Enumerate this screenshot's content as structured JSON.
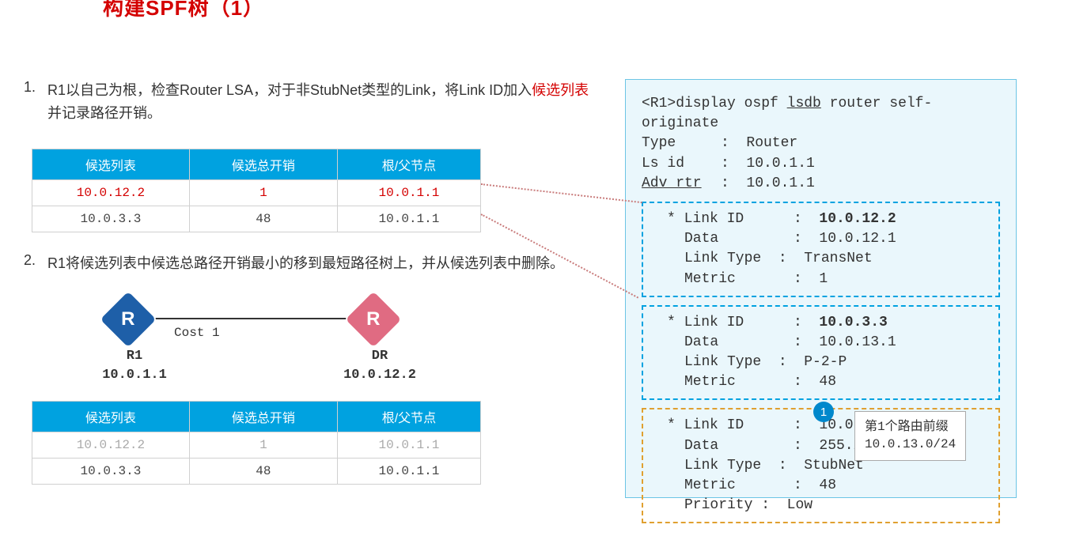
{
  "title": "构建SPF树（1）",
  "step1": {
    "num": "1.",
    "text_before": "R1以自己为根，检查Router LSA，对于非StubNet类型的Link，将Link ID加入",
    "highlight": "候选列表",
    "text_after": "并记录路径开销。"
  },
  "table1": {
    "headers": [
      "候选列表",
      "候选总开销",
      "根/父节点"
    ],
    "rows": [
      {
        "cells": [
          "10.0.12.2",
          "1",
          "10.0.1.1"
        ],
        "class": "red"
      },
      {
        "cells": [
          "10.0.3.3",
          "48",
          "10.0.1.1"
        ],
        "class": ""
      }
    ]
  },
  "step2": {
    "num": "2.",
    "text": "R1将候选列表中候选总路径开销最小的移到最短路径树上，并从候选列表中删除。"
  },
  "topo": {
    "cost_label": "Cost 1",
    "r1": {
      "name": "R1",
      "id": "10.0.1.1"
    },
    "dr": {
      "name": "DR",
      "id": "10.0.12.2"
    }
  },
  "table2": {
    "headers": [
      "候选列表",
      "候选总开销",
      "根/父节点"
    ],
    "rows": [
      {
        "cells": [
          "10.0.12.2",
          "1",
          "10.0.1.1"
        ],
        "class": "grey"
      },
      {
        "cells": [
          "10.0.3.3",
          "48",
          "10.0.1.1"
        ],
        "class": ""
      }
    ]
  },
  "lsdb": {
    "cmd_prefix": "<R1>display ospf ",
    "cmd_u1": "lsdb",
    "cmd_mid": " router self-originate",
    "type_label": "Type",
    "type_value": "Router",
    "lsid_label": "Ls id",
    "lsid_value": "10.0.1.1",
    "adv_label": "Adv rtr",
    "adv_value": "10.0.1.1",
    "links": [
      {
        "box_class": "dash-blue",
        "link_id_label": "* Link ID",
        "link_id": "10.0.12.2",
        "link_id_bold": true,
        "data_label": "Data",
        "data": "10.0.12.1",
        "type_label": "Link Type",
        "type": "TransNet",
        "metric_label": "Metric",
        "metric": "1"
      },
      {
        "box_class": "dash-blue",
        "link_id_label": "* Link ID",
        "link_id": "10.0.3.3",
        "link_id_bold": true,
        "data_label": "Data",
        "data": "10.0.13.1",
        "type_label": "Link Type",
        "type": "P-2-P",
        "metric_label": "Metric",
        "metric": "48"
      },
      {
        "box_class": "dash-orange",
        "link_id_label": "* Link ID",
        "link_id": "10.0.13.0",
        "link_id_bold": false,
        "data_label": "Data",
        "data": "255.255.255.0",
        "type_label": "Link Type",
        "type": "StubNet",
        "metric_label": "Metric",
        "metric": "48",
        "priority_label": "Priority",
        "priority": "Low"
      }
    ]
  },
  "annotation": {
    "badge": "1",
    "line1": "第1个路由前缀",
    "line2": "10.0.13.0/24"
  }
}
